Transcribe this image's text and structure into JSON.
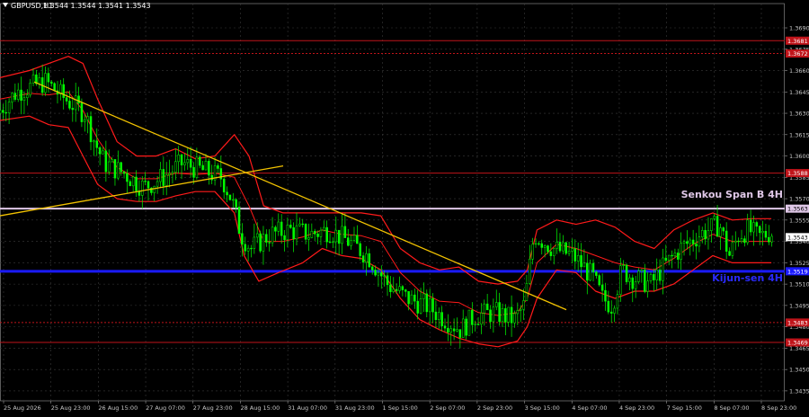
{
  "header": {
    "symbol": "GBPUSD,H1",
    "ohlc": "1.3544 1.3544 1.3541 1.3543"
  },
  "colors": {
    "background": "#000000",
    "grid": "#3a3a3a",
    "candle": "#00ff00",
    "bollinger": "#ff1a1a",
    "trendline": "#f2c200",
    "level_line": "#c0141a",
    "kijun": "#1a1aff",
    "senkou": "#e0c8e8"
  },
  "labels": {
    "senkou": "Senkou Span B 4H",
    "kijun": "Kijun-sen 4H"
  },
  "chart_data": {
    "type": "line",
    "ylim": [
      1.3428,
      1.3702
    ],
    "y_ticks": [
      "1.3690",
      "1.3675",
      "1.3660",
      "1.3645",
      "1.3630",
      "1.3615",
      "1.3600",
      "1.3585",
      "1.3570",
      "1.3555",
      "1.3540",
      "1.3525",
      "1.3510",
      "1.3495",
      "1.3480",
      "1.3465",
      "1.3450",
      "1.3435"
    ],
    "x_labels": [
      "25 Aug 2026",
      "25 Aug 23:00",
      "26 Aug 15:00",
      "27 Aug 07:00",
      "27 Aug 23:00",
      "28 Aug 15:00",
      "31 Aug 07:00",
      "31 Aug 23:00",
      "1 Sep 15:00",
      "2 Sep 07:00",
      "2 Sep 23:00",
      "3 Sep 15:00",
      "4 Sep 07:00",
      "4 Sep 23:00",
      "7 Sep 15:00",
      "8 Sep 07:00",
      "8 Sep 23:00"
    ],
    "x_range": [
      0,
      160
    ],
    "price_tags": [
      {
        "text": "1.3681",
        "y": 1.3681,
        "color": "#c0141a"
      },
      {
        "text": "1.3672",
        "y": 1.3672,
        "color": "#c0141a"
      },
      {
        "text": "1.3588",
        "y": 1.3588,
        "color": "#c0141a"
      },
      {
        "text": "1.3563",
        "y": 1.3563,
        "color": "#e0c8e8"
      },
      {
        "text": "1.3543",
        "y": 1.3543,
        "color": "#ffffff"
      },
      {
        "text": "1.3519",
        "y": 1.3519,
        "color": "#1a1aff"
      },
      {
        "text": "1.3483",
        "y": 1.3483,
        "color": "#c0141a"
      },
      {
        "text": "1.3469",
        "y": 1.3469,
        "color": "#c0141a"
      }
    ],
    "levels": [
      {
        "y": 1.3681,
        "color": "#c0141a",
        "width": 1
      },
      {
        "y": 1.3672,
        "color": "#c0141a",
        "width": 1,
        "dash": "2,2"
      },
      {
        "y": 1.3588,
        "color": "#c0141a",
        "width": 1
      },
      {
        "y": 1.3563,
        "color": "#e0c8e8",
        "width": 2
      },
      {
        "y": 1.3519,
        "color": "#1a1aff",
        "width": 3
      },
      {
        "y": 1.3483,
        "color": "#c0141a",
        "width": 1,
        "dash": "2,2"
      },
      {
        "y": 1.3469,
        "color": "#c0141a",
        "width": 1
      }
    ],
    "price_series": [
      [
        0,
        1.363
      ],
      [
        4,
        1.3645
      ],
      [
        8,
        1.365
      ],
      [
        10,
        1.3652
      ],
      [
        14,
        1.364
      ],
      [
        18,
        1.363
      ],
      [
        20,
        1.361
      ],
      [
        22,
        1.3595
      ],
      [
        26,
        1.3588
      ],
      [
        30,
        1.3578
      ],
      [
        34,
        1.3585
      ],
      [
        38,
        1.3595
      ],
      [
        42,
        1.359
      ],
      [
        46,
        1.3585
      ],
      [
        48,
        1.357
      ],
      [
        50,
        1.3545
      ],
      [
        52,
        1.3535
      ],
      [
        56,
        1.3545
      ],
      [
        60,
        1.3548
      ],
      [
        64,
        1.3545
      ],
      [
        68,
        1.3548
      ],
      [
        72,
        1.354
      ],
      [
        76,
        1.353
      ],
      [
        80,
        1.351
      ],
      [
        84,
        1.35
      ],
      [
        88,
        1.3495
      ],
      [
        92,
        1.3485
      ],
      [
        95,
        1.3478
      ],
      [
        98,
        1.3488
      ],
      [
        102,
        1.349
      ],
      [
        106,
        1.3485
      ],
      [
        108,
        1.3495
      ],
      [
        110,
        1.3545
      ],
      [
        114,
        1.3535
      ],
      [
        118,
        1.353
      ],
      [
        122,
        1.3515
      ],
      [
        124,
        1.35
      ],
      [
        126,
        1.3495
      ],
      [
        128,
        1.352
      ],
      [
        130,
        1.3515
      ],
      [
        134,
        1.351
      ],
      [
        136,
        1.352
      ],
      [
        140,
        1.3535
      ],
      [
        144,
        1.3545
      ],
      [
        148,
        1.3552
      ],
      [
        150,
        1.353
      ],
      [
        152,
        1.3545
      ],
      [
        154,
        1.3548
      ],
      [
        156,
        1.3543
      ],
      [
        158,
        1.3546
      ]
    ],
    "bb_upper": [
      [
        0,
        1.3655
      ],
      [
        6,
        1.366
      ],
      [
        10,
        1.3665
      ],
      [
        14,
        1.367
      ],
      [
        17,
        1.3665
      ],
      [
        20,
        1.364
      ],
      [
        24,
        1.361
      ],
      [
        28,
        1.36
      ],
      [
        32,
        1.36
      ],
      [
        36,
        1.3605
      ],
      [
        40,
        1.3598
      ],
      [
        44,
        1.36
      ],
      [
        48,
        1.3615
      ],
      [
        51,
        1.36
      ],
      [
        54,
        1.3565
      ],
      [
        58,
        1.356
      ],
      [
        62,
        1.356
      ],
      [
        66,
        1.356
      ],
      [
        70,
        1.356
      ],
      [
        74,
        1.356
      ],
      [
        78,
        1.3558
      ],
      [
        82,
        1.3535
      ],
      [
        86,
        1.3525
      ],
      [
        90,
        1.352
      ],
      [
        94,
        1.3522
      ],
      [
        98,
        1.3512
      ],
      [
        102,
        1.351
      ],
      [
        106,
        1.3512
      ],
      [
        108,
        1.352
      ],
      [
        110,
        1.3548
      ],
      [
        114,
        1.3555
      ],
      [
        118,
        1.3552
      ],
      [
        122,
        1.3555
      ],
      [
        126,
        1.355
      ],
      [
        130,
        1.354
      ],
      [
        134,
        1.3535
      ],
      [
        138,
        1.3548
      ],
      [
        142,
        1.3555
      ],
      [
        146,
        1.356
      ],
      [
        150,
        1.3555
      ],
      [
        154,
        1.3556
      ],
      [
        158,
        1.3556
      ]
    ],
    "bb_lower": [
      [
        0,
        1.3625
      ],
      [
        6,
        1.3628
      ],
      [
        10,
        1.3622
      ],
      [
        14,
        1.362
      ],
      [
        17,
        1.36
      ],
      [
        20,
        1.358
      ],
      [
        24,
        1.357
      ],
      [
        28,
        1.3568
      ],
      [
        32,
        1.3568
      ],
      [
        36,
        1.3572
      ],
      [
        40,
        1.3575
      ],
      [
        44,
        1.3575
      ],
      [
        48,
        1.356
      ],
      [
        50,
        1.353
      ],
      [
        53,
        1.3512
      ],
      [
        57,
        1.3518
      ],
      [
        62,
        1.3525
      ],
      [
        66,
        1.3535
      ],
      [
        70,
        1.353
      ],
      [
        74,
        1.3528
      ],
      [
        78,
        1.352
      ],
      [
        82,
        1.35
      ],
      [
        86,
        1.3485
      ],
      [
        90,
        1.3478
      ],
      [
        94,
        1.3472
      ],
      [
        98,
        1.3468
      ],
      [
        102,
        1.3466
      ],
      [
        106,
        1.347
      ],
      [
        108,
        1.348
      ],
      [
        110,
        1.35
      ],
      [
        114,
        1.352
      ],
      [
        118,
        1.3518
      ],
      [
        122,
        1.3505
      ],
      [
        126,
        1.35
      ],
      [
        130,
        1.3505
      ],
      [
        134,
        1.3505
      ],
      [
        138,
        1.351
      ],
      [
        142,
        1.352
      ],
      [
        146,
        1.353
      ],
      [
        150,
        1.3525
      ],
      [
        154,
        1.3525
      ],
      [
        158,
        1.3525
      ]
    ],
    "bb_middle": [
      [
        0,
        1.364
      ],
      [
        6,
        1.3644
      ],
      [
        10,
        1.3643
      ],
      [
        14,
        1.3645
      ],
      [
        17,
        1.3632
      ],
      [
        20,
        1.3612
      ],
      [
        24,
        1.3592
      ],
      [
        28,
        1.3584
      ],
      [
        32,
        1.3584
      ],
      [
        36,
        1.3588
      ],
      [
        40,
        1.3587
      ],
      [
        44,
        1.3588
      ],
      [
        48,
        1.3585
      ],
      [
        51,
        1.3565
      ],
      [
        54,
        1.354
      ],
      [
        58,
        1.354
      ],
      [
        62,
        1.3543
      ],
      [
        66,
        1.3548
      ],
      [
        70,
        1.3545
      ],
      [
        74,
        1.3544
      ],
      [
        78,
        1.354
      ],
      [
        82,
        1.3518
      ],
      [
        86,
        1.3505
      ],
      [
        90,
        1.3498
      ],
      [
        94,
        1.3497
      ],
      [
        98,
        1.349
      ],
      [
        102,
        1.3488
      ],
      [
        106,
        1.349
      ],
      [
        108,
        1.35
      ],
      [
        110,
        1.3525
      ],
      [
        114,
        1.3538
      ],
      [
        118,
        1.3535
      ],
      [
        122,
        1.353
      ],
      [
        126,
        1.3525
      ],
      [
        130,
        1.3522
      ],
      [
        134,
        1.352
      ],
      [
        138,
        1.3528
      ],
      [
        142,
        1.3538
      ],
      [
        146,
        1.3545
      ],
      [
        150,
        1.354
      ],
      [
        154,
        1.354
      ],
      [
        158,
        1.354
      ]
    ],
    "trendlines": [
      {
        "x1": 7,
        "y1": 1.3652,
        "x2": 116,
        "y2": 1.3492
      },
      {
        "x1": 0,
        "y1": 1.3558,
        "x2": 58,
        "y2": 1.3593
      }
    ],
    "grid": true
  }
}
